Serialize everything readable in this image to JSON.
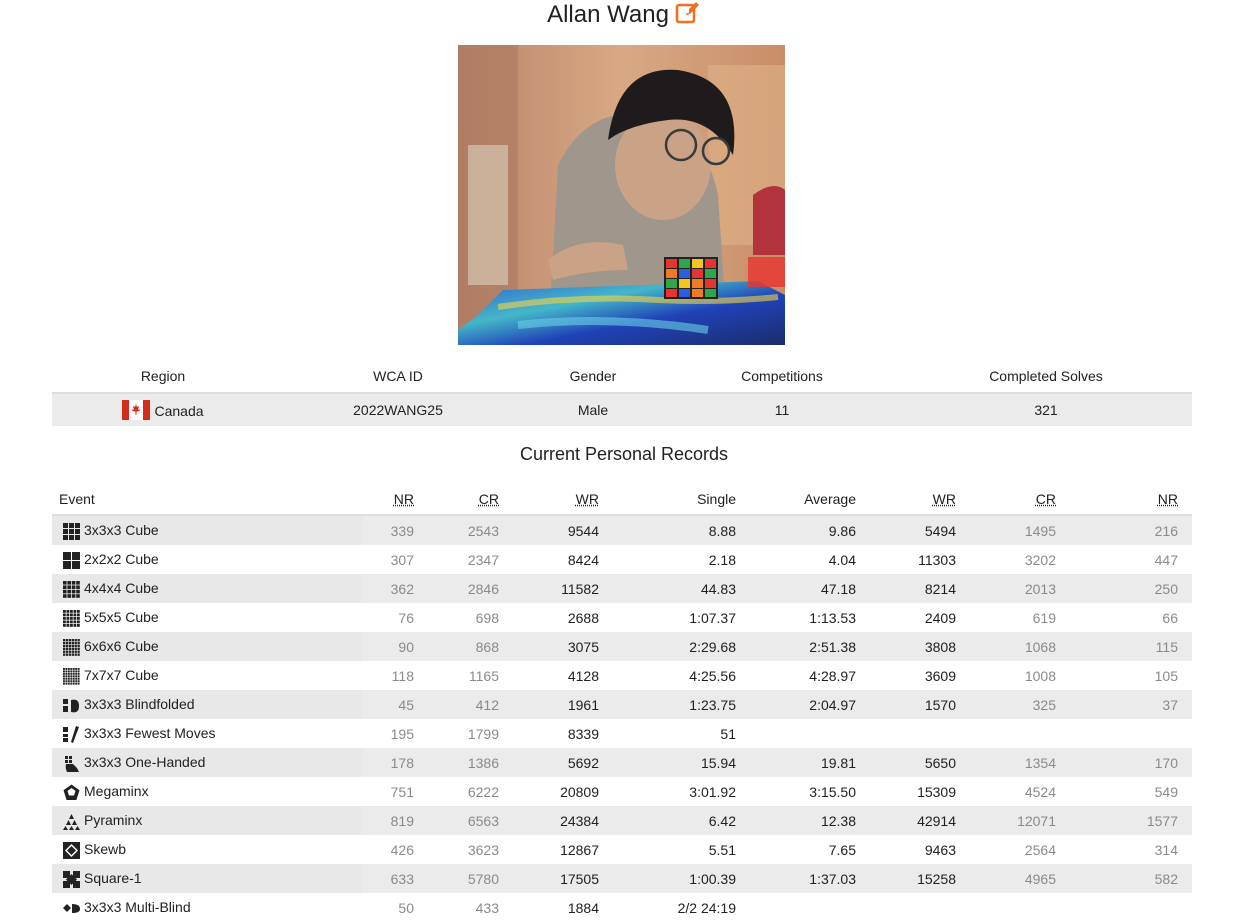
{
  "profile": {
    "name": "Allan Wang",
    "edit_icon": "edit-icon",
    "photo_alt": "profile photo"
  },
  "info": {
    "headers": [
      "Region",
      "WCA ID",
      "Gender",
      "Competitions",
      "Completed Solves"
    ],
    "region": "Canada",
    "region_flag": "canada-flag-icon",
    "wca_id": "2022WANG25",
    "gender": "Male",
    "competitions": "11",
    "completed_solves": "321"
  },
  "records": {
    "title": "Current Personal Records",
    "headers": {
      "event": "Event",
      "single_nr": "NR",
      "single_cr": "CR",
      "single_wr": "WR",
      "single": "Single",
      "average": "Average",
      "avg_wr": "WR",
      "avg_cr": "CR",
      "avg_nr": "NR"
    },
    "rows": [
      {
        "event": "3x3x3 Cube",
        "icon": "333-icon",
        "snr": "339",
        "scr": "2543",
        "swr": "9544",
        "single": "8.88",
        "average": "9.86",
        "awr": "5494",
        "acr": "1495",
        "anr": "216"
      },
      {
        "event": "2x2x2 Cube",
        "icon": "222-icon",
        "snr": "307",
        "scr": "2347",
        "swr": "8424",
        "single": "2.18",
        "average": "4.04",
        "awr": "11303",
        "acr": "3202",
        "anr": "447"
      },
      {
        "event": "4x4x4 Cube",
        "icon": "444-icon",
        "snr": "362",
        "scr": "2846",
        "swr": "11582",
        "single": "44.83",
        "average": "47.18",
        "awr": "8214",
        "acr": "2013",
        "anr": "250"
      },
      {
        "event": "5x5x5 Cube",
        "icon": "555-icon",
        "snr": "76",
        "scr": "698",
        "swr": "2688",
        "single": "1:07.37",
        "average": "1:13.53",
        "awr": "2409",
        "acr": "619",
        "anr": "66"
      },
      {
        "event": "6x6x6 Cube",
        "icon": "666-icon",
        "snr": "90",
        "scr": "868",
        "swr": "3075",
        "single": "2:29.68",
        "average": "2:51.38",
        "awr": "3808",
        "acr": "1068",
        "anr": "115"
      },
      {
        "event": "7x7x7 Cube",
        "icon": "777-icon",
        "snr": "118",
        "scr": "1165",
        "swr": "4128",
        "single": "4:25.56",
        "average": "4:28.97",
        "awr": "3609",
        "acr": "1008",
        "anr": "105"
      },
      {
        "event": "3x3x3 Blindfolded",
        "icon": "blindfolded-icon",
        "snr": "45",
        "scr": "412",
        "swr": "1961",
        "single": "1:23.75",
        "average": "2:04.97",
        "awr": "1570",
        "acr": "325",
        "anr": "37"
      },
      {
        "event": "3x3x3 Fewest Moves",
        "icon": "fewest-moves-icon",
        "snr": "195",
        "scr": "1799",
        "swr": "8339",
        "single": "51",
        "average": "",
        "awr": "",
        "acr": "",
        "anr": ""
      },
      {
        "event": "3x3x3 One-Handed",
        "icon": "one-handed-icon",
        "snr": "178",
        "scr": "1386",
        "swr": "5692",
        "single": "15.94",
        "average": "19.81",
        "awr": "5650",
        "acr": "1354",
        "anr": "170"
      },
      {
        "event": "Megaminx",
        "icon": "megaminx-icon",
        "snr": "751",
        "scr": "6222",
        "swr": "20809",
        "single": "3:01.92",
        "average": "3:15.50",
        "awr": "15309",
        "acr": "4524",
        "anr": "549"
      },
      {
        "event": "Pyraminx",
        "icon": "pyraminx-icon",
        "snr": "819",
        "scr": "6563",
        "swr": "24384",
        "single": "6.42",
        "average": "12.38",
        "awr": "42914",
        "acr": "12071",
        "anr": "1577"
      },
      {
        "event": "Skewb",
        "icon": "skewb-icon",
        "snr": "426",
        "scr": "3623",
        "swr": "12867",
        "single": "5.51",
        "average": "7.65",
        "awr": "9463",
        "acr": "2564",
        "anr": "314"
      },
      {
        "event": "Square-1",
        "icon": "square1-icon",
        "snr": "633",
        "scr": "5780",
        "swr": "17505",
        "single": "1:00.39",
        "average": "1:37.03",
        "awr": "15258",
        "acr": "4965",
        "anr": "582"
      },
      {
        "event": "3x3x3 Multi-Blind",
        "icon": "multi-blind-icon",
        "snr": "50",
        "scr": "433",
        "swr": "1884",
        "single": "2/2 24:19",
        "average": "",
        "awr": "",
        "acr": "",
        "anr": ""
      }
    ]
  }
}
